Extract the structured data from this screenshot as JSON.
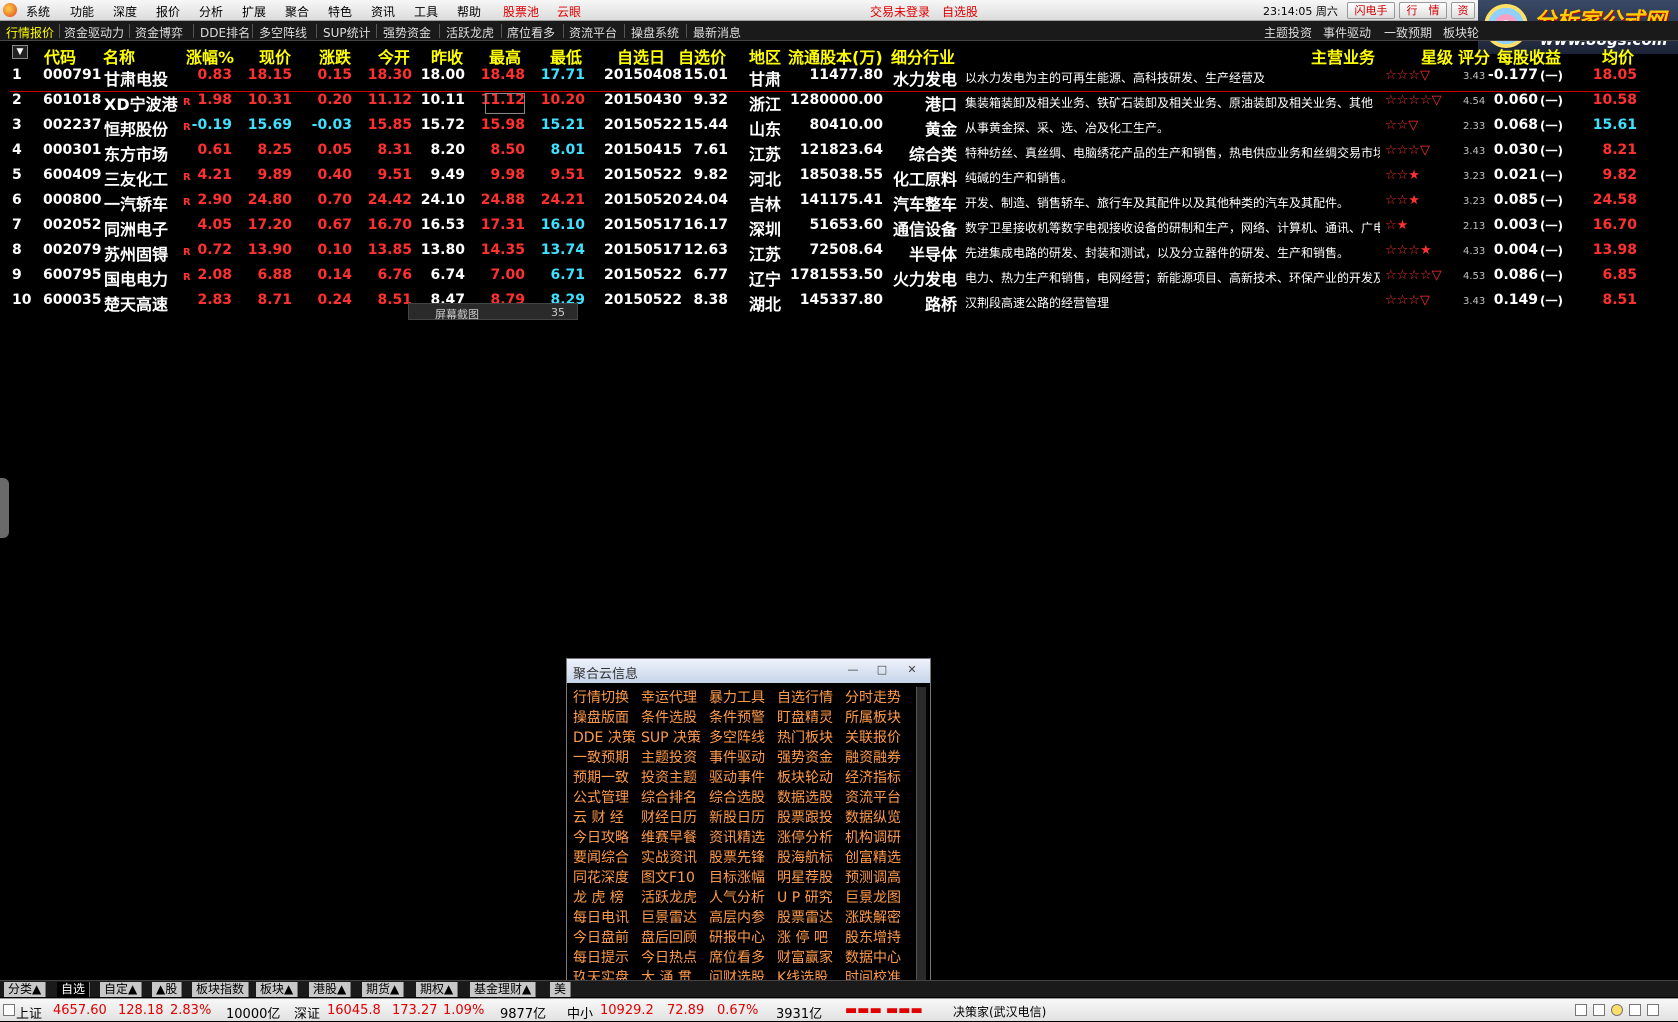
{
  "menu": {
    "items": [
      "系统",
      "功能",
      "深度",
      "报价",
      "分析",
      "扩展",
      "聚合",
      "特色",
      "资讯",
      "工具",
      "帮助"
    ],
    "stock_pool": "股票池",
    "cloud_eye": "云眼",
    "login_status": "交易未登录",
    "watchlist": "自选股",
    "clock": "23:14:05 周六",
    "buttons": [
      "闪电手",
      "行　情",
      "资"
    ]
  },
  "brand": {
    "title": "分析家公式网",
    "url": "www.88gs.com"
  },
  "tabs": {
    "left": [
      "行情报价",
      "资金驱动力",
      "资金博弈",
      "DDE排名",
      "多空阵线",
      "SUP统计",
      "强势资金",
      "活跃龙虎",
      "席位看多",
      "资流平台",
      "操盘系统",
      "最新消息"
    ],
    "right": [
      "主题投资",
      "事件驱动",
      "一致预期",
      "板块轮"
    ]
  },
  "table": {
    "columns": [
      "代码",
      "名称",
      "涨幅%",
      "现价",
      "涨跌",
      "今开",
      "昨收",
      "最高",
      "最低",
      "自选日",
      "自选价",
      "地区",
      "流通股本(万)",
      "细分行业",
      "主营业务",
      "星级",
      "评分",
      "每股收益",
      "均价"
    ],
    "rows": [
      {
        "no": "1",
        "code": "000791",
        "name": "甘肃电投",
        "flag": "",
        "pct": "0.83",
        "price": "18.15",
        "chg": "0.15",
        "open": "18.30",
        "prev": "18.00",
        "high": "18.48",
        "low": "17.71",
        "date": "20150408",
        "selp": "15.01",
        "region": "甘肃",
        "shares": "11477.80",
        "industry": "水力发电",
        "biz": "以水力发电为主的可再生能源、高科技研发、生产经营及",
        "stars": "☆☆☆▽",
        "score": "3.43",
        "eps": "-0.177",
        "avg": "18.05",
        "c_pct": "r",
        "c_price": "r",
        "c_chg": "r",
        "c_open": "r",
        "c_high": "r",
        "c_low": "c",
        "c_avg": "r"
      },
      {
        "no": "2",
        "code": "601018",
        "name": "XD宁波港",
        "flag": "R",
        "pct": "1.98",
        "price": "10.31",
        "chg": "0.20",
        "open": "11.12",
        "prev": "10.11",
        "high": "11.12",
        "low": "10.20",
        "date": "20150430",
        "selp": "9.32",
        "region": "浙江",
        "shares": "1280000.00",
        "industry": "港口",
        "biz": "集装箱装卸及相关业务、铁矿石装卸及相关业务、原油装卸及相关业务、其他",
        "stars": "☆☆☆☆▽",
        "score": "4.54",
        "eps": "0.060",
        "avg": "10.58",
        "c_pct": "r",
        "c_price": "r",
        "c_chg": "r",
        "c_open": "r",
        "c_high": "r",
        "c_low": "r",
        "c_avg": "r"
      },
      {
        "no": "3",
        "code": "002237",
        "name": "恒邦股份",
        "flag": "R",
        "pct": "-0.19",
        "price": "15.69",
        "chg": "-0.03",
        "open": "15.85",
        "prev": "15.72",
        "high": "15.98",
        "low": "15.21",
        "date": "20150522",
        "selp": "15.44",
        "region": "山东",
        "shares": "80410.00",
        "industry": "黄金",
        "biz": "从事黄金探、采、选、冶及化工生产。",
        "stars": "☆☆▽",
        "score": "2.33",
        "eps": "0.068",
        "avg": "15.61",
        "c_pct": "c",
        "c_price": "c",
        "c_chg": "c",
        "c_open": "r",
        "c_high": "r",
        "c_low": "c",
        "c_avg": "c"
      },
      {
        "no": "4",
        "code": "000301",
        "name": "东方市场",
        "flag": "",
        "pct": "0.61",
        "price": "8.25",
        "chg": "0.05",
        "open": "8.31",
        "prev": "8.20",
        "high": "8.50",
        "low": "8.01",
        "date": "20150415",
        "selp": "7.61",
        "region": "江苏",
        "shares": "121823.64",
        "industry": "综合类",
        "biz": "特种纺丝、真丝绸、电脑绣花产品的生产和销售，热电供应业务和丝绸交易市场",
        "stars": "☆☆☆▽",
        "score": "3.43",
        "eps": "0.030",
        "avg": "8.21",
        "c_pct": "r",
        "c_price": "r",
        "c_chg": "r",
        "c_open": "r",
        "c_high": "r",
        "c_low": "c",
        "c_avg": "r"
      },
      {
        "no": "5",
        "code": "600409",
        "name": "三友化工",
        "flag": "R",
        "pct": "4.21",
        "price": "9.89",
        "chg": "0.40",
        "open": "9.51",
        "prev": "9.49",
        "high": "9.98",
        "low": "9.51",
        "date": "20150522",
        "selp": "9.82",
        "region": "河北",
        "shares": "185038.55",
        "industry": "化工原料",
        "biz": "纯碱的生产和销售。",
        "stars": "☆☆★",
        "score": "3.23",
        "eps": "0.021",
        "avg": "9.82",
        "c_pct": "r",
        "c_price": "r",
        "c_chg": "r",
        "c_open": "r",
        "c_high": "r",
        "c_low": "r",
        "c_avg": "r"
      },
      {
        "no": "6",
        "code": "000800",
        "name": "一汽轿车",
        "flag": "R",
        "pct": "2.90",
        "price": "24.80",
        "chg": "0.70",
        "open": "24.42",
        "prev": "24.10",
        "high": "24.88",
        "low": "24.21",
        "date": "20150520",
        "selp": "24.04",
        "region": "吉林",
        "shares": "141175.41",
        "industry": "汽车整车",
        "biz": "开发、制造、销售轿车、旅行车及其配件以及其他种类的汽车及其配件。",
        "stars": "☆☆★",
        "score": "3.23",
        "eps": "0.085",
        "avg": "24.58",
        "c_pct": "r",
        "c_price": "r",
        "c_chg": "r",
        "c_open": "r",
        "c_high": "r",
        "c_low": "r",
        "c_avg": "r"
      },
      {
        "no": "7",
        "code": "002052",
        "name": "同洲电子",
        "flag": "",
        "pct": "4.05",
        "price": "17.20",
        "chg": "0.67",
        "open": "16.70",
        "prev": "16.53",
        "high": "17.31",
        "low": "16.10",
        "date": "20150517",
        "selp": "16.17",
        "region": "深圳",
        "shares": "51653.60",
        "industry": "通信设备",
        "biz": "数字卫星接收机等数字电视接收设备的研制和生产，网络、计算机、通讯、广电",
        "stars": "☆★",
        "score": "2.13",
        "eps": "0.003",
        "avg": "16.70",
        "c_pct": "r",
        "c_price": "r",
        "c_chg": "r",
        "c_open": "r",
        "c_high": "r",
        "c_low": "c",
        "c_avg": "r"
      },
      {
        "no": "8",
        "code": "002079",
        "name": "苏州固锝",
        "flag": "R",
        "pct": "0.72",
        "price": "13.90",
        "chg": "0.10",
        "open": "13.85",
        "prev": "13.80",
        "high": "14.35",
        "low": "13.74",
        "date": "20150517",
        "selp": "12.63",
        "region": "江苏",
        "shares": "72508.64",
        "industry": "半导体",
        "biz": "先进集成电路的研发、封装和测试，以及分立器件的研发、生产和销售。",
        "stars": "☆☆☆★",
        "score": "4.33",
        "eps": "0.004",
        "avg": "13.98",
        "c_pct": "r",
        "c_price": "r",
        "c_chg": "r",
        "c_open": "r",
        "c_high": "r",
        "c_low": "c",
        "c_avg": "r"
      },
      {
        "no": "9",
        "code": "600795",
        "name": "国电电力",
        "flag": "R",
        "pct": "2.08",
        "price": "6.88",
        "chg": "0.14",
        "open": "6.76",
        "prev": "6.74",
        "high": "7.00",
        "low": "6.71",
        "date": "20150522",
        "selp": "6.77",
        "region": "辽宁",
        "shares": "1781553.50",
        "industry": "火力发电",
        "biz": "电力、热力生产和销售，电网经营；新能源项目、高新技术、环保产业的开发及",
        "stars": "☆☆☆☆▽",
        "score": "4.53",
        "eps": "0.086",
        "avg": "6.85",
        "c_pct": "r",
        "c_price": "r",
        "c_chg": "r",
        "c_open": "r",
        "c_high": "r",
        "c_low": "c",
        "c_avg": "r"
      },
      {
        "no": "10",
        "code": "600035",
        "name": "楚天高速",
        "flag": "",
        "pct": "2.83",
        "price": "8.71",
        "chg": "0.24",
        "open": "8.51",
        "prev": "8.47",
        "high": "8.79",
        "low": "8.29",
        "date": "20150522",
        "selp": "8.38",
        "region": "湖北",
        "shares": "145337.80",
        "industry": "路桥",
        "biz": "汉荆段高速公路的经营管理",
        "stars": "☆☆☆▽",
        "score": "3.43",
        "eps": "0.149",
        "avg": "8.51",
        "c_pct": "r",
        "c_price": "r",
        "c_chg": "r",
        "c_open": "r",
        "c_high": "r",
        "c_low": "c",
        "c_avg": "r"
      }
    ],
    "eps_icon": "(一)"
  },
  "tooltip": {
    "label": "屏幕截图",
    "value": "35"
  },
  "popup": {
    "title": "聚合云信息",
    "window_buttons": [
      "—",
      "□",
      "✕"
    ],
    "items": [
      [
        "行情切换",
        "幸运代理",
        "暴力工具",
        "自选行情",
        "分时走势"
      ],
      [
        "操盘版面",
        "条件选股",
        "条件预警",
        "盯盘精灵",
        "所属板块"
      ],
      [
        "DDE 决策",
        "SUP 决策",
        "多空阵线",
        "热门板块",
        "关联报价"
      ],
      [
        "一致预期",
        "主题投资",
        "事件驱动",
        "强势资金",
        "融资融券"
      ],
      [
        "预期一致",
        "投资主题",
        "驱动事件",
        "板块轮动",
        "经济指标"
      ],
      [
        "公式管理",
        "综合排名",
        "综合选股",
        "数据选股",
        "资流平台"
      ],
      [
        "云 财 经",
        "财经日历",
        "新股日历",
        "股票跟投",
        "数据纵览"
      ],
      [
        "今日攻略",
        "维赛早餐",
        "资讯精选",
        "涨停分析",
        "机构调研"
      ],
      [
        "要闻综合",
        "实战资讯",
        "股票先锋",
        "股海航标",
        "创富精选"
      ],
      [
        "同花深度",
        "图文F10",
        "目标涨幅",
        "明星荐股",
        "预测调高"
      ],
      [
        "龙 虎 榜",
        "活跃龙虎",
        "人气分析",
        "U P 研究",
        "巨景龙图"
      ],
      [
        "每日电讯",
        "巨景雷达",
        "高层内参",
        "股票雷达",
        "涨跌解密"
      ],
      [
        "今日盘前",
        "盘后回顾",
        "研报中心",
        "涨 停 吧",
        "股东增持"
      ],
      [
        "每日提示",
        "今日热点",
        "席位看多",
        "财富赢家",
        "数据中心"
      ],
      [
        "玖天实盘",
        "大 涌 贯",
        "问财选股",
        "K线选股",
        "时间校准"
      ]
    ]
  },
  "bottom_tabs": [
    "分类▲",
    "自选",
    "自定▲",
    "▲股",
    "板块指数",
    "板块▲",
    "港股▲",
    "期货▲",
    "期权▲",
    "基金理财▲",
    "美"
  ],
  "status": {
    "sh_label": "上证",
    "sh_index": "4657.60",
    "sh_chg": "128.18",
    "sh_pct": "2.83%",
    "sh_vol": "10000亿",
    "sz_label": "深证",
    "sz_index": "16045.8",
    "sz_chg": "173.27",
    "sz_pct": "1.09%",
    "sz_vol": "9877亿",
    "zx_label": "中小",
    "zx_index": "10929.2",
    "zx_chg": "72.89",
    "zx_pct": "0.67%",
    "zx_vol": "3931亿",
    "bars": "▬▬▬ ▬▬▬",
    "server": "决策家(武汉电信)"
  },
  "colors": {
    "red": "#ff3030",
    "cyan": "#40e0ff",
    "white": "#ffffff",
    "yellow": "#ffff00",
    "orange": "#ff9a4a"
  }
}
